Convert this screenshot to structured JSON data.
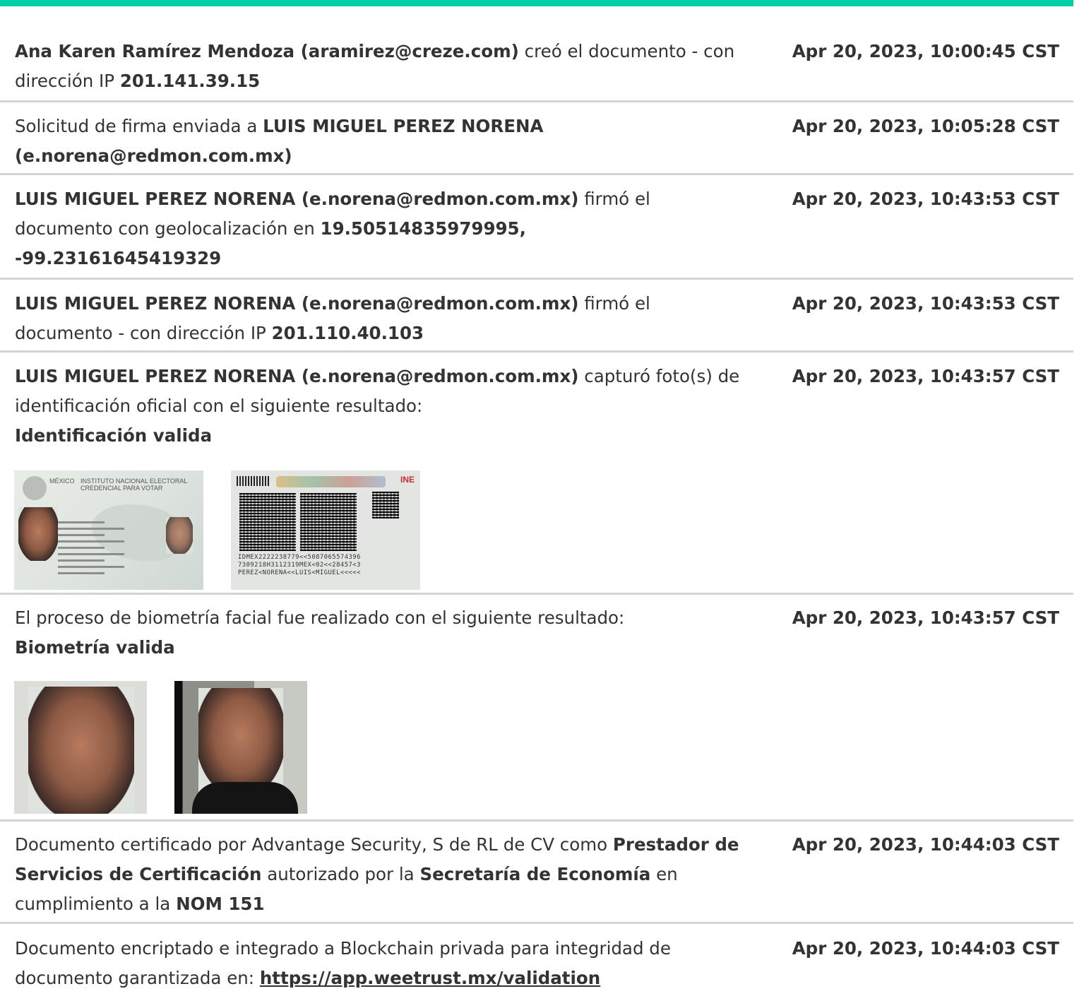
{
  "accent_color": "#00d1a4",
  "entries": [
    {
      "segments": [
        {
          "text": "Ana Karen Ramírez Mendoza (aramirez@creze.com)",
          "bold": true
        },
        {
          "text": " creó el documento - con dirección IP ",
          "bold": false
        },
        {
          "text": "201.141.39.15",
          "bold": true
        }
      ],
      "timestamp": "Apr 20, 2023, 10:00:45 CST"
    },
    {
      "segments": [
        {
          "text": "Solicitud de firma enviada a ",
          "bold": false
        },
        {
          "text": "LUIS MIGUEL PEREZ NORENA (e.norena@redmon.com.mx)",
          "bold": true
        }
      ],
      "timestamp": "Apr 20, 2023, 10:05:28 CST"
    },
    {
      "segments": [
        {
          "text": "LUIS MIGUEL PEREZ NORENA (e.norena@redmon.com.mx)",
          "bold": true
        },
        {
          "text": " firmó el documento con geolocalización en ",
          "bold": false
        },
        {
          "text": "19.50514835979995, -99.23161645419329",
          "bold": true
        }
      ],
      "timestamp": "Apr 20, 2023, 10:43:53 CST"
    },
    {
      "segments": [
        {
          "text": "LUIS MIGUEL PEREZ NORENA (e.norena@redmon.com.mx)",
          "bold": true
        },
        {
          "text": " firmó el documento - con dirección IP ",
          "bold": false
        },
        {
          "text": "201.110.40.103",
          "bold": true
        }
      ],
      "timestamp": "Apr 20, 2023, 10:43:53 CST"
    },
    {
      "segments": [
        {
          "text": "LUIS MIGUEL PEREZ NORENA (e.norena@redmon.com.mx)",
          "bold": true
        },
        {
          "text": " capturó foto(s) de identificación oficial con el siguiente resultado:",
          "bold": false
        }
      ],
      "result": "Identificación valida",
      "timestamp": "Apr 20, 2023, 10:43:57 CST",
      "images": {
        "front": {
          "country": "MÉXICO",
          "header": "INSTITUTO NACIONAL ELECTORAL",
          "subheader": "CREDENCIAL PARA VOTAR"
        },
        "back": {
          "logo": "INE",
          "mrz": [
            "IDMEX2222238779<<5087065574396",
            "7309218H3112319MEX<02<<28457<3",
            "PEREZ<NORENA<<LUIS<MIGUEL<<<<<"
          ]
        }
      }
    },
    {
      "segments": [
        {
          "text": "El proceso de biometría facial fue realizado con el siguiente resultado:",
          "bold": false
        }
      ],
      "result": "Biometría valida",
      "timestamp": "Apr 20, 2023, 10:43:57 CST"
    },
    {
      "segments": [
        {
          "text": "Documento certificado por Advantage Security, S de RL de CV como ",
          "bold": false
        },
        {
          "text": "Prestador de Servicios de Certificación",
          "bold": true
        },
        {
          "text": " autorizado por la ",
          "bold": false
        },
        {
          "text": "Secretaría de Economía",
          "bold": true
        },
        {
          "text": " en cumplimiento a la ",
          "bold": false
        },
        {
          "text": "NOM 151",
          "bold": true
        }
      ],
      "timestamp": "Apr 20, 2023, 10:44:03 CST"
    },
    {
      "segments": [
        {
          "text": "Documento encriptado e integrado a Blockchain privada para integridad de documento garantizada en: ",
          "bold": false
        },
        {
          "text": "https://app.weetrust.mx/validation",
          "bold": true,
          "link": true
        }
      ],
      "timestamp": "Apr 20, 2023, 10:44:03 CST"
    }
  ]
}
